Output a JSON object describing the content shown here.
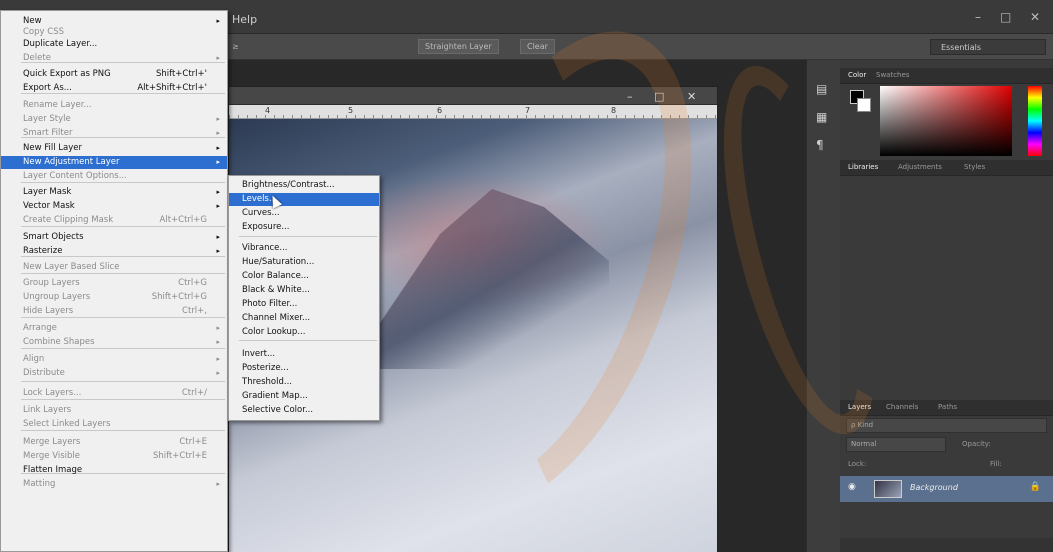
{
  "menubar": {
    "help": "Help",
    "min": "–",
    "max": "□",
    "close": "✕"
  },
  "optionsbar": {
    "small_label": "≥",
    "straighten": "Straighten Layer",
    "clear": "Clear",
    "essentials": "Essentials"
  },
  "document": {
    "ruler_ticks": [
      "4",
      "5",
      "6",
      "7",
      "8"
    ],
    "minimize": "–",
    "maximize": "□",
    "close": "✕"
  },
  "menu": {
    "items": [
      {
        "label": "New",
        "arrow": "▸",
        "disabled": false
      },
      {
        "label": "Copy CSS",
        "disabled": true
      },
      {
        "label": "Duplicate Layer...",
        "disabled": false
      },
      {
        "label": "Delete",
        "arrow": "▸",
        "disabled": true
      },
      {
        "label": "Quick Export as PNG",
        "shortcut": "Shift+Ctrl+'",
        "disabled": false
      },
      {
        "label": "Export As...",
        "shortcut": "Alt+Shift+Ctrl+'",
        "disabled": false
      },
      {
        "label": "Rename Layer...",
        "disabled": true
      },
      {
        "label": "Layer Style",
        "arrow": "▸",
        "disabled": true
      },
      {
        "label": "Smart Filter",
        "arrow": "▸",
        "disabled": true
      },
      {
        "label": "New Fill Layer",
        "arrow": "▸",
        "disabled": false
      },
      {
        "label": "New Adjustment Layer",
        "arrow": "▸",
        "disabled": false,
        "highlighted": true
      },
      {
        "label": "Layer Content Options...",
        "disabled": true
      },
      {
        "label": "Layer Mask",
        "arrow": "▸",
        "disabled": false
      },
      {
        "label": "Vector Mask",
        "arrow": "▸",
        "disabled": false
      },
      {
        "label": "Create Clipping Mask",
        "shortcut": "Alt+Ctrl+G",
        "disabled": true
      },
      {
        "label": "Smart Objects",
        "arrow": "▸",
        "disabled": false
      },
      {
        "label": "Rasterize",
        "arrow": "▸",
        "disabled": false
      },
      {
        "label": "New Layer Based Slice",
        "disabled": true
      },
      {
        "label": "Group Layers",
        "shortcut": "Ctrl+G",
        "disabled": true
      },
      {
        "label": "Ungroup Layers",
        "shortcut": "Shift+Ctrl+G",
        "disabled": true
      },
      {
        "label": "Hide Layers",
        "shortcut": "Ctrl+,",
        "disabled": true
      },
      {
        "label": "Arrange",
        "arrow": "▸",
        "disabled": true
      },
      {
        "label": "Combine Shapes",
        "arrow": "▸",
        "disabled": true
      },
      {
        "label": "Align",
        "arrow": "▸",
        "disabled": true
      },
      {
        "label": "Distribute",
        "arrow": "▸",
        "disabled": true
      },
      {
        "label": "Lock Layers...",
        "shortcut": "Ctrl+/",
        "disabled": true
      },
      {
        "label": "Link Layers",
        "disabled": true
      },
      {
        "label": "Select Linked Layers",
        "disabled": true
      },
      {
        "label": "Merge Layers",
        "shortcut": "Ctrl+E",
        "disabled": true
      },
      {
        "label": "Merge Visible",
        "shortcut": "Shift+Ctrl+E",
        "disabled": true
      },
      {
        "label": "Flatten Image",
        "disabled": false
      },
      {
        "label": "Matting",
        "arrow": "▸",
        "disabled": true
      }
    ]
  },
  "submenu": {
    "items": [
      {
        "label": "Brightness/Contrast..."
      },
      {
        "label": "Levels...",
        "highlighted": true
      },
      {
        "label": "Curves..."
      },
      {
        "label": "Exposure..."
      },
      {
        "label": "Vibrance..."
      },
      {
        "label": "Hue/Saturation..."
      },
      {
        "label": "Color Balance..."
      },
      {
        "label": "Black & White..."
      },
      {
        "label": "Photo Filter..."
      },
      {
        "label": "Channel Mixer..."
      },
      {
        "label": "Color Lookup..."
      },
      {
        "label": "Invert..."
      },
      {
        "label": "Posterize..."
      },
      {
        "label": "Threshold..."
      },
      {
        "label": "Gradient Map..."
      },
      {
        "label": "Selective Color..."
      }
    ]
  },
  "panels": {
    "color_tabs": [
      "Color",
      "Swatches"
    ],
    "lib_tabs": [
      "Libraries",
      "Adjustments",
      "Styles"
    ],
    "layer_tabs": [
      "Layers",
      "Channels",
      "Paths"
    ],
    "kind": "ρ Kind",
    "mode": "Normal",
    "opacity_label": "Opacity:",
    "lock_label": "Lock:",
    "fill_label": "Fill:",
    "layer_name": "Background",
    "colors": {
      "accent": "#2d6fd1",
      "layer_selected": "#5b6f8f"
    }
  }
}
